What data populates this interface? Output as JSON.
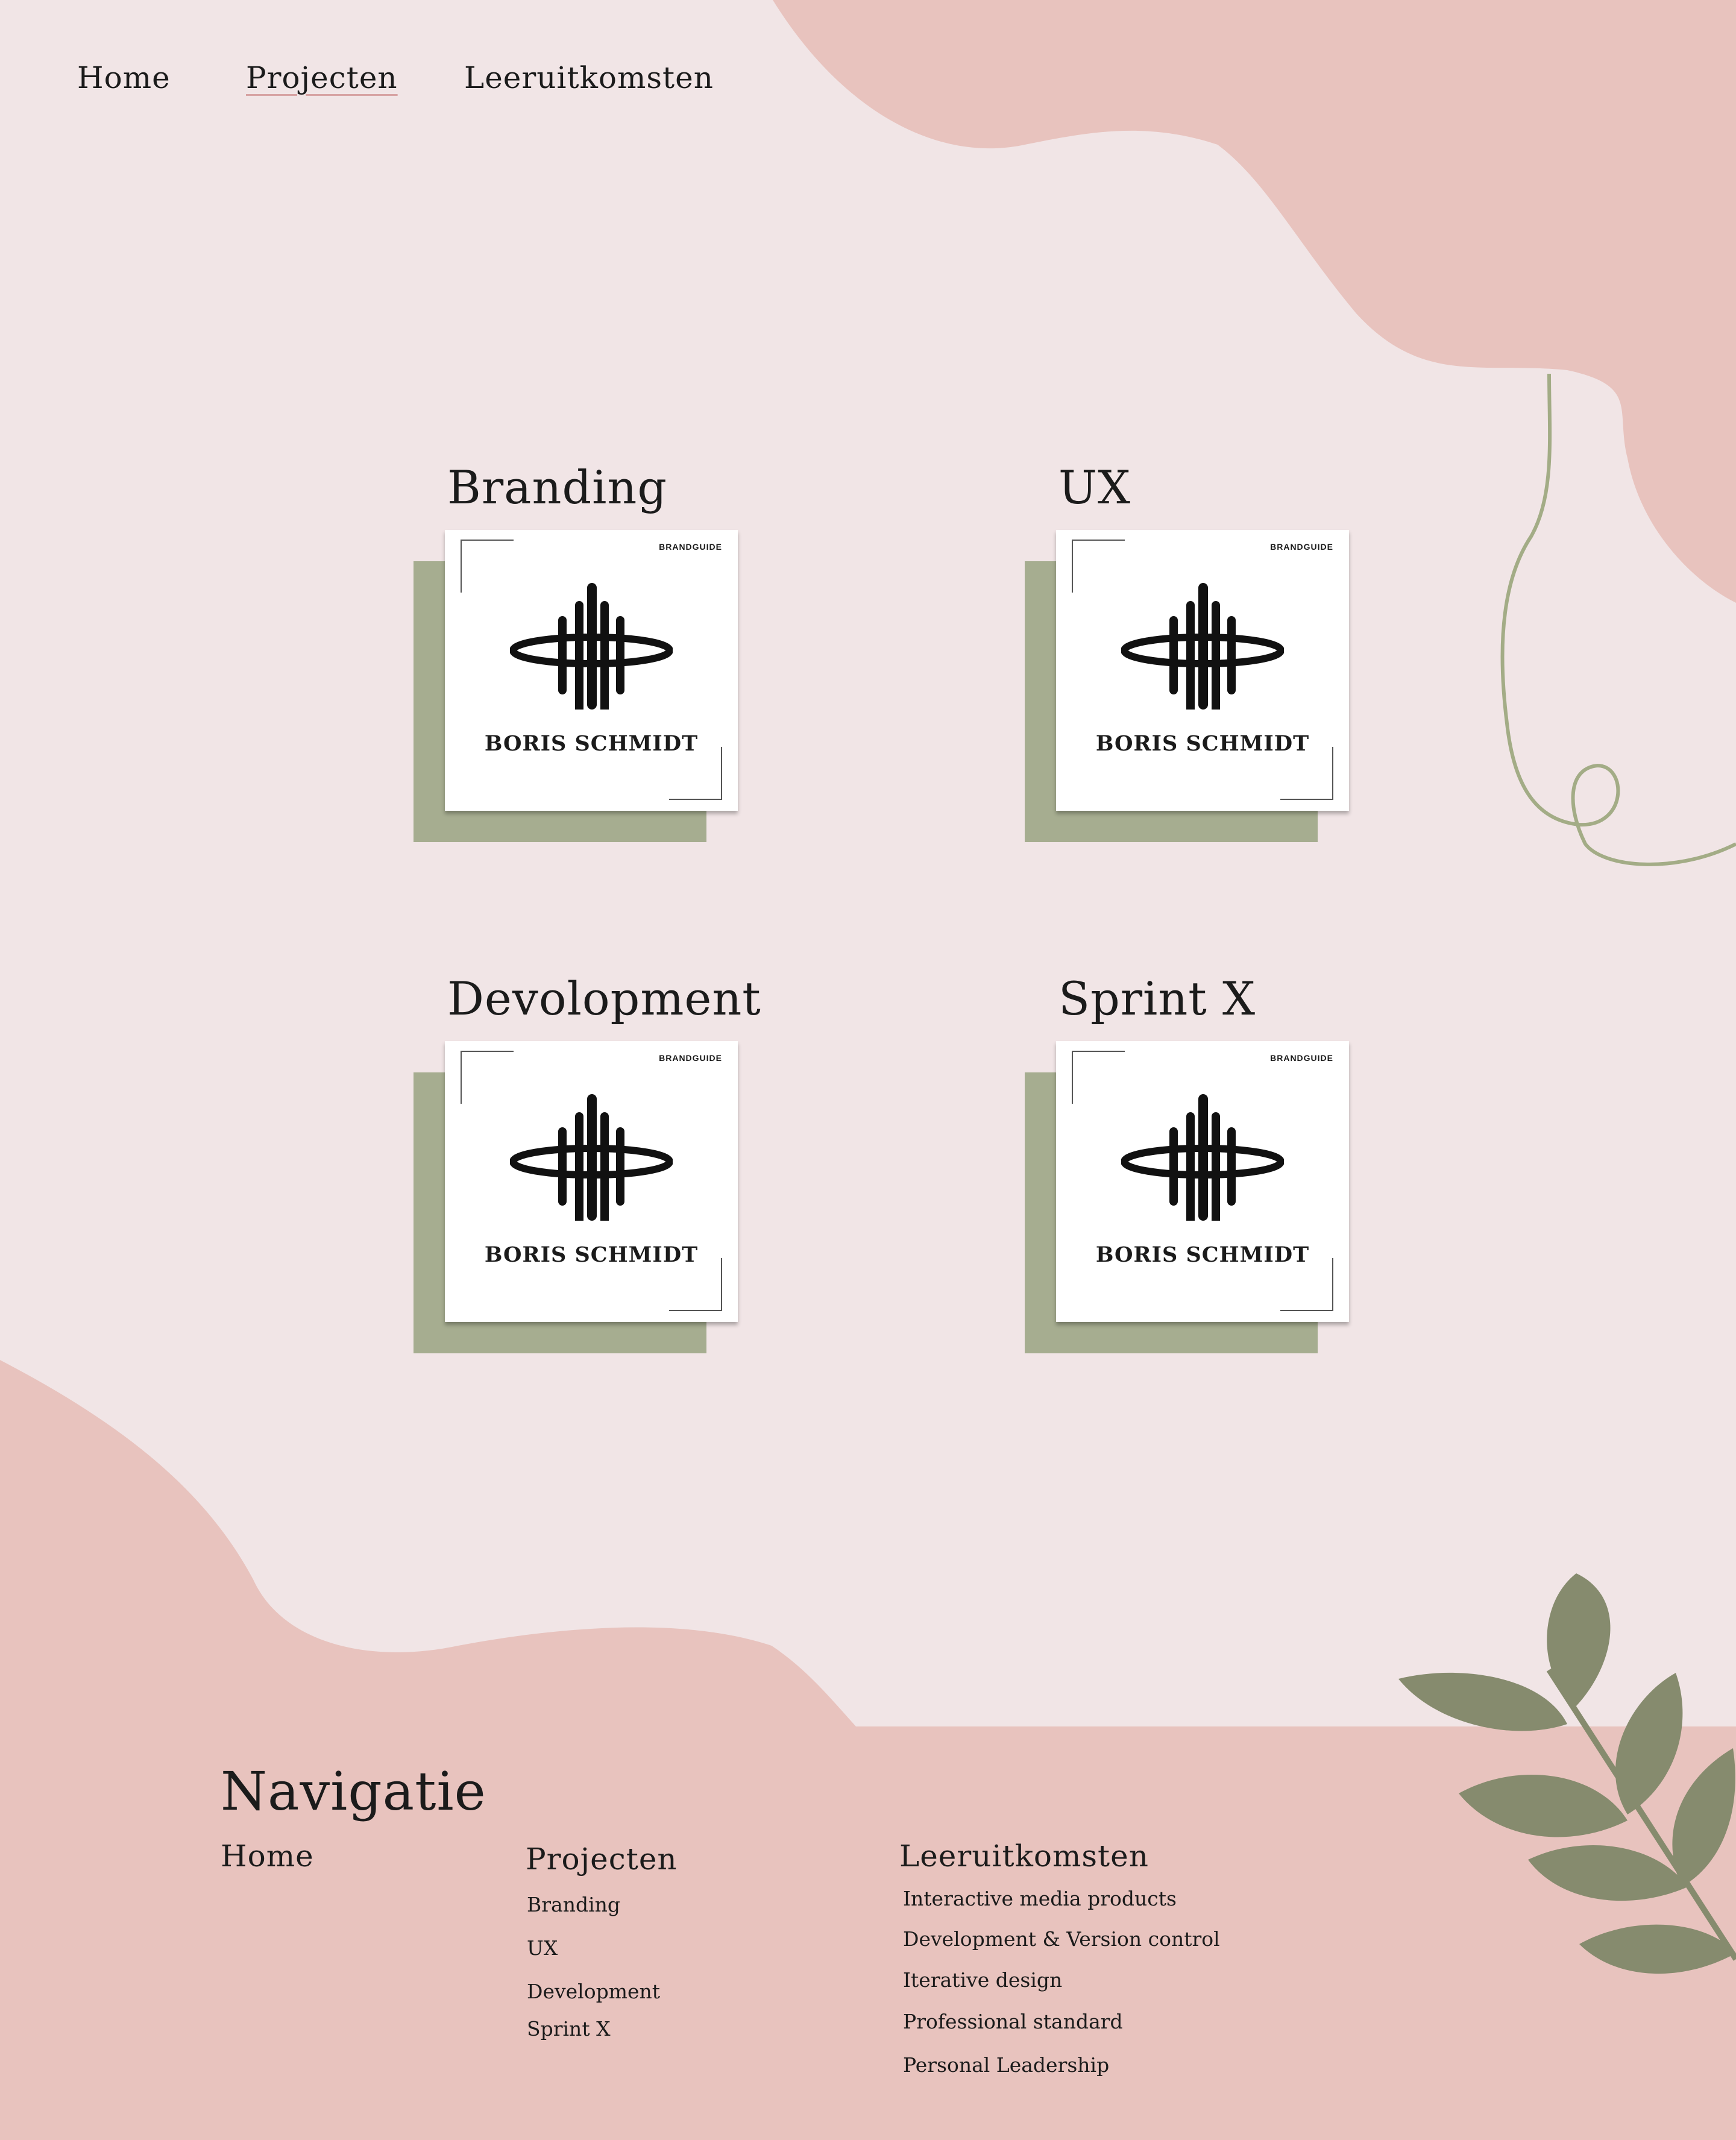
{
  "nav": {
    "home": "Home",
    "projecten": "Projecten",
    "leeruitkomsten": "Leeruitkomsten"
  },
  "projects": [
    {
      "title": "Branding",
      "tile_label": "BRANDGUIDE",
      "tile_name": "BORIS SCHMIDT"
    },
    {
      "title": "UX",
      "tile_label": "BRANDGUIDE",
      "tile_name": "BORIS SCHMIDT"
    },
    {
      "title": "Devolopment",
      "tile_label": "BRANDGUIDE",
      "tile_name": "BORIS SCHMIDT"
    },
    {
      "title": "Sprint X",
      "tile_label": "BRANDGUIDE",
      "tile_name": "BORIS SCHMIDT"
    }
  ],
  "footer": {
    "title": "Navigatie",
    "home": "Home",
    "projecten_heading": "Projecten",
    "projecten_items": [
      "Branding",
      "UX",
      "Development",
      "Sprint X"
    ],
    "leeruitkomsten_heading": "Leeruitkomsten",
    "leeruitkomsten_items": [
      "Interactive media products",
      "Development & Version control",
      "Iterative design",
      "Professional standard",
      "Personal Leadership"
    ]
  },
  "colors": {
    "background": "#f1e5e6",
    "blob": "#e8c3be",
    "card_shadow": "#a6ad90",
    "line": "#a3ac86",
    "leaf": "#868b6e"
  },
  "icons": [
    "brand-logo-icon",
    "leaf-branch-icon",
    "curly-line-decoration"
  ]
}
